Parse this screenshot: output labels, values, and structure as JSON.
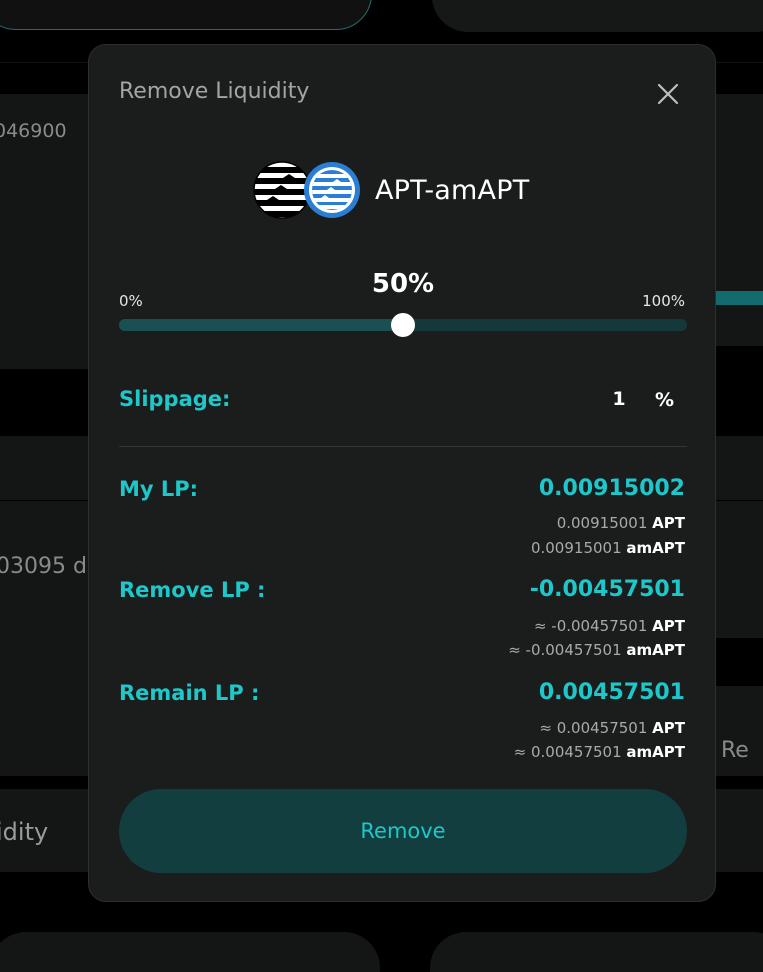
{
  "background": {
    "fragment_1": "046900",
    "fragment_2": "03095 d",
    "fragment_3": "d Re",
    "fragment_4": "idity"
  },
  "modal": {
    "title": "Remove Liquidity",
    "close_icon": "close-icon",
    "pair": {
      "name": "APT-amAPT",
      "token_a_icon": "apt-token-icon",
      "token_b_icon": "amapt-token-icon"
    },
    "slider": {
      "value_label": "50%",
      "value": 50,
      "min_label": "0%",
      "max_label": "100%"
    },
    "slippage": {
      "label": "Slippage:",
      "value": "1",
      "unit": "%"
    },
    "my_lp": {
      "label": "My LP:",
      "value": "0.00915002",
      "lines": [
        {
          "amount": "0.00915001",
          "unit": "APT"
        },
        {
          "amount": "0.00915001",
          "unit": "amAPT"
        }
      ]
    },
    "remove_lp": {
      "label": "Remove LP :",
      "value": "-0.00457501",
      "lines": [
        {
          "amount": "≈ -0.00457501",
          "unit": "APT"
        },
        {
          "amount": "≈ -0.00457501",
          "unit": "amAPT"
        }
      ]
    },
    "remain_lp": {
      "label": "Remain LP :",
      "value": "0.00457501",
      "lines": [
        {
          "amount": "≈ 0.00457501",
          "unit": "APT"
        },
        {
          "amount": "≈ 0.00457501",
          "unit": "amAPT"
        }
      ]
    },
    "remove_button": "Remove"
  },
  "colors": {
    "accent": "#1ec7c9",
    "modal_bg": "#1b1d1d",
    "button_bg": "#133e40",
    "track_bg": "#15393a"
  }
}
